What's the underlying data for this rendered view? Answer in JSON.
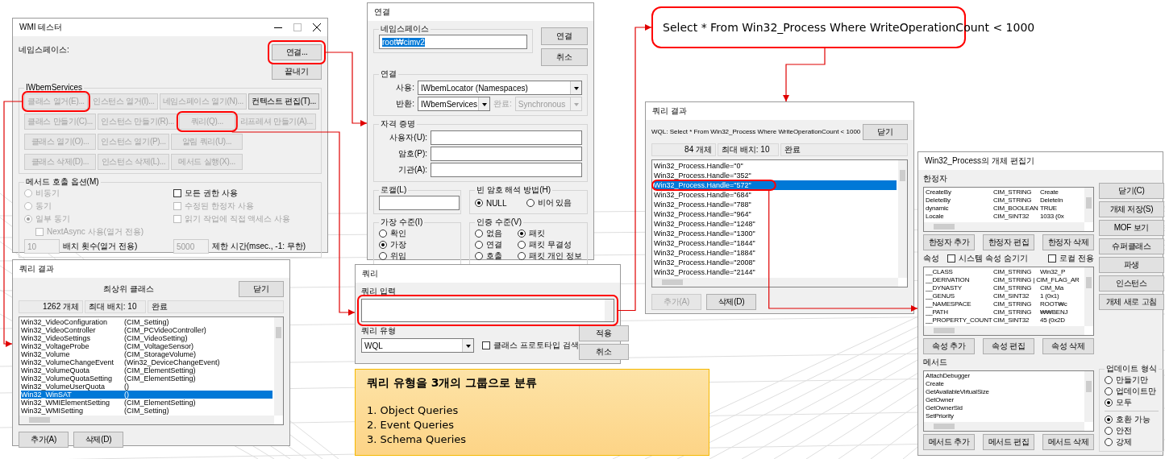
{
  "tester": {
    "title": "WMI 테스터",
    "namespace_label": "네임스페이스:",
    "buttons": [
      {
        "label": "연결...",
        "disabled": false
      },
      {
        "label": "끝내기",
        "disabled": false
      }
    ],
    "services_title": "IWbemServices",
    "service_rows": [
      {
        "buttons": [
          {
            "label": "클래스 열거(E)...",
            "disabled": true
          },
          {
            "label": "인스턴스 열거(I)...",
            "disabled": true
          },
          {
            "label": "네임스페이스 열기(N)...",
            "disabled": true
          },
          {
            "label": "컨텍스트 편집(T)...",
            "disabled": false
          }
        ]
      },
      {
        "buttons": [
          {
            "label": "클래스 만들기(C)...",
            "disabled": true
          },
          {
            "label": "인스턴스 만들기(R)...",
            "disabled": true
          },
          {
            "label": "쿼리(Q)...",
            "disabled": true
          },
          {
            "label": "리프레셔 만들기(A)...",
            "disabled": true
          }
        ]
      },
      {
        "buttons": [
          {
            "label": "클래스 열기(O)...",
            "disabled": true
          },
          {
            "label": "인스턴스 열기(P)...",
            "disabled": true
          },
          {
            "label": "알림 쿼리(U)...",
            "disabled": true
          }
        ]
      },
      {
        "buttons": [
          {
            "label": "클래스 삭제(D)...",
            "disabled": true
          },
          {
            "label": "인스턴스 삭제(L)...",
            "disabled": true
          },
          {
            "label": "메서드 실행(X)...",
            "disabled": true
          }
        ]
      }
    ],
    "options_title": "메서드 호출 옵션(M)",
    "radios": [
      {
        "label": "비동기",
        "selected": false,
        "disabled": true
      },
      {
        "label": "동기",
        "selected": false,
        "disabled": true
      },
      {
        "label": "일부 동기",
        "selected": true,
        "disabled": true
      }
    ],
    "checkboxes": [
      {
        "label": "모든 권한 사용",
        "checked": false,
        "disabled": false
      },
      {
        "label": "수정된 한정자 사용",
        "checked": false,
        "disabled": true
      },
      {
        "label": "읽기 작업에 직접 액세스 사용",
        "checked": false,
        "disabled": true
      }
    ],
    "next_async": {
      "label": "NextAsync 사용(열거 전용)",
      "checked": false,
      "disabled": true
    },
    "batch": {
      "value": "10",
      "label": "배치 횟수(열거 전용)",
      "disabled": true
    },
    "timeout": {
      "value": "5000",
      "label": "제한 시간(msec., -1: 무한)",
      "disabled": true
    }
  },
  "connect": {
    "title": "연결",
    "namespace_title": "네임스페이스",
    "namespace_value": "root₩cimv2",
    "namespace_text_selected": true,
    "buttons": [
      "연결",
      "취소"
    ],
    "connection_title": "연결",
    "using_label": "사용:",
    "using_value": "IWbemLocator (Namespaces)",
    "returning_label": "반환:",
    "returning_value": "IWbemServices",
    "completion_label": "완료:",
    "completion_value": "Synchronous",
    "completion_disabled": true,
    "credentials_title": "자격 증명",
    "credential_labels": [
      "사용자(U):",
      "암호(P):",
      "기관(A):"
    ],
    "locale_title": "로캘(L)",
    "null_password_title": "빈 암호 해석 방법(H)",
    "null_password_options": [
      {
        "label": "NULL",
        "selected": true
      },
      {
        "label": "비어 있음",
        "selected": false
      }
    ],
    "impersonation_title": "가장 수준(I)",
    "impersonation_options": [
      {
        "label": "확인",
        "selected": false
      },
      {
        "label": "가장",
        "selected": true
      },
      {
        "label": "위임",
        "selected": false
      }
    ],
    "authentication_title": "인증 수준(V)",
    "authentication_options": [
      {
        "label": "없음",
        "selected": false
      },
      {
        "label": "패킷",
        "selected": true
      },
      {
        "label": "연결",
        "selected": false
      },
      {
        "label": "패킷 무결성",
        "selected": false
      },
      {
        "label": "호출",
        "selected": false
      },
      {
        "label": "패킷 개인 정보",
        "selected": false
      }
    ]
  },
  "class_results": {
    "title": "쿼리 결과",
    "heading": "최상위 클래스",
    "close_label": "닫기",
    "count": "1262 개체",
    "batch": "최대 배치: 10",
    "status": "완료",
    "rows": [
      {
        "name": "Win32_VideoConfiguration",
        "parent": "(CIM_Setting)",
        "selected": false
      },
      {
        "name": "Win32_VideoController",
        "parent": "(CIM_PCVideoController)",
        "selected": false
      },
      {
        "name": "Win32_VideoSettings",
        "parent": "(CIM_VideoSetting)",
        "selected": false
      },
      {
        "name": "Win32_VoltageProbe",
        "parent": "(CIM_VoltageSensor)",
        "selected": false
      },
      {
        "name": "Win32_Volume",
        "parent": "(CIM_StorageVolume)",
        "selected": false
      },
      {
        "name": "Win32_VolumeChangeEvent",
        "parent": "(Win32_DeviceChangeEvent)",
        "selected": false
      },
      {
        "name": "Win32_VolumeQuota",
        "parent": "(CIM_ElementSetting)",
        "selected": false
      },
      {
        "name": "Win32_VolumeQuotaSetting",
        "parent": "(CIM_ElementSetting)",
        "selected": false
      },
      {
        "name": "Win32_VolumeUserQuota",
        "parent": "()",
        "selected": false
      },
      {
        "name": "Win32_WinSAT",
        "parent": "()",
        "selected": true
      },
      {
        "name": "Win32_WMIElementSetting",
        "parent": "(CIM_ElementSetting)",
        "selected": false
      },
      {
        "name": "Win32_WMISetting",
        "parent": "(CIM_Setting)",
        "selected": false
      }
    ],
    "buttons": [
      {
        "label": "추가(A)",
        "disabled": false
      },
      {
        "label": "삭제(D)",
        "disabled": false
      }
    ]
  },
  "query": {
    "title": "쿼리",
    "input_label": "쿼리 입력",
    "type_label": "쿼리 유형",
    "type_value": "WQL",
    "prototype": {
      "label": "클래스 프로토타입 검색",
      "checked": false
    },
    "buttons": [
      "적용",
      "취소"
    ]
  },
  "note": {
    "title": "쿼리 유형을 3개의 그룹으로 분류",
    "items": [
      "1. Object Queries",
      "2. Event Queries",
      "3. Schema Queries"
    ]
  },
  "callout": {
    "text": "Select * From Win32_Process Where WriteOperationCount < 1000"
  },
  "instance_results": {
    "title": "쿼리 결과",
    "query": "WQL: Select * From Win32_Process Where WriteOperationCount < 1000",
    "close_label": "닫기",
    "count": "84 개체",
    "batch": "최대 배치: 10",
    "status": "완료",
    "rows": [
      {
        "text": "Win32_Process.Handle=\"0\"",
        "selected": false
      },
      {
        "text": "Win32_Process.Handle=\"352\"",
        "selected": false
      },
      {
        "text": "Win32_Process.Handle=\"572\"",
        "selected": true
      },
      {
        "text": "Win32_Process.Handle=\"684\"",
        "selected": false
      },
      {
        "text": "Win32_Process.Handle=\"788\"",
        "selected": false
      },
      {
        "text": "Win32_Process.Handle=\"964\"",
        "selected": false
      },
      {
        "text": "Win32_Process.Handle=\"1248\"",
        "selected": false
      },
      {
        "text": "Win32_Process.Handle=\"1300\"",
        "selected": false
      },
      {
        "text": "Win32_Process.Handle=\"1844\"",
        "selected": false
      },
      {
        "text": "Win32_Process.Handle=\"1884\"",
        "selected": false
      },
      {
        "text": "Win32_Process.Handle=\"2008\"",
        "selected": false
      },
      {
        "text": "Win32_Process.Handle=\"2144\"",
        "selected": false
      }
    ],
    "buttons": [
      {
        "label": "추가(A)",
        "disabled": true
      },
      {
        "label": "삭제(D)",
        "disabled": false
      }
    ]
  },
  "editor": {
    "title": "Win32_Process의 개체 편집기",
    "qualifiers_label": "한정자",
    "qualifiers": [
      {
        "name": "CreateBy",
        "type": "CIM_STRING",
        "value": "Create"
      },
      {
        "name": "DeleteBy",
        "type": "CIM_STRING",
        "value": "DeleteIn"
      },
      {
        "name": "dynamic",
        "type": "CIM_BOOLEAN",
        "value": "TRUE"
      },
      {
        "name": "Locale",
        "type": "CIM_SINT32",
        "value": "1033 (0x"
      }
    ],
    "qualifier_buttons": [
      "한정자 추가",
      "한정자 편집",
      "한정자 삭제"
    ],
    "properties_label": "속성",
    "hide_system": {
      "label": "시스템 속성 숨기기",
      "checked": false
    },
    "local_only": {
      "label": "로컬 전용",
      "checked": false
    },
    "properties": [
      {
        "name": "__CLASS",
        "type": "CIM_STRING",
        "value": "Win32_P"
      },
      {
        "name": "__DERIVATION",
        "type": "CIM_STRING | CIM_FLAG_AR"
      },
      {
        "name": "__DYNASTY",
        "type": "CIM_STRING",
        "value": "CIM_Ma"
      },
      {
        "name": "__GENUS",
        "type": "CIM_SINT32",
        "value": "1 (0x1)"
      },
      {
        "name": "__NAMESPACE",
        "type": "CIM_STRING",
        "value": "ROOT₩c"
      },
      {
        "name": "__PATH",
        "type": "CIM_STRING",
        "value": "₩₩BENJ"
      },
      {
        "name": "__PROPERTY_COUNT",
        "type": "CIM_SINT32",
        "value": "45 (0x2D"
      }
    ],
    "property_buttons": [
      "속성 추가",
      "속성 편집",
      "속성 삭제"
    ],
    "methods_label": "메서드",
    "methods": [
      "AttachDebugger",
      "Create",
      "GetAvailableVirtualSize",
      "GetOwner",
      "GetOwnerSid",
      "SetPriority"
    ],
    "method_buttons": [
      "메서드 추가",
      "메서드 편집",
      "메서드 삭제"
    ],
    "side_buttons": [
      "닫기(C)",
      "개체 저장(S)",
      "MOF 보기",
      "슈퍼클래스",
      "파생",
      "인스턴스",
      "개체 새로 고침"
    ],
    "update_title": "업데이트 형식",
    "update_options": [
      {
        "label": "만들기만",
        "selected": false
      },
      {
        "label": "업데이트만",
        "selected": false
      },
      {
        "label": "모두",
        "selected": true
      }
    ],
    "compat_options": [
      {
        "label": "호환 가능",
        "selected": true
      },
      {
        "label": "안전",
        "selected": false
      },
      {
        "label": "강제",
        "selected": false
      }
    ]
  }
}
